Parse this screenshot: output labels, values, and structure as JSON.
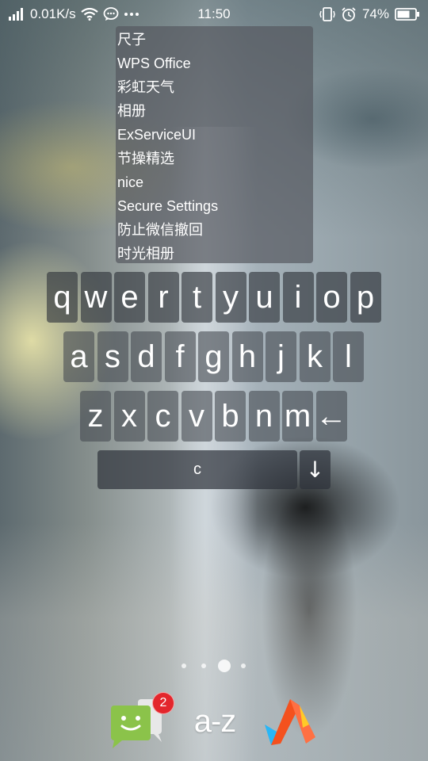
{
  "status_bar": {
    "network_speed": "0.01K/s",
    "time": "11:50",
    "battery": "74%",
    "icons": [
      "signal-icon",
      "wifi-icon",
      "message-icon",
      "more-icon",
      "vibrate-icon",
      "alarm-icon",
      "battery-icon"
    ]
  },
  "suggestions": [
    "尺子",
    "WPS Office",
    "彩虹天气",
    "相册",
    "ExServiceUI",
    "节操精选",
    "nice",
    "Secure Settings",
    "防止微信撤回",
    "时光相册"
  ],
  "keyboard": {
    "row1": [
      "q",
      "w",
      "e",
      "r",
      "t",
      "y",
      "u",
      "i",
      "o",
      "p"
    ],
    "row2": [
      "a",
      "s",
      "d",
      "f",
      "g",
      "h",
      "j",
      "k",
      "l"
    ],
    "row3": [
      "z",
      "x",
      "c",
      "v",
      "b",
      "n",
      "m",
      "←"
    ],
    "space_label": "c",
    "down_label": "↓"
  },
  "page_indicator": {
    "pages": 4,
    "current": 3
  },
  "dock": {
    "messages_badge": "2",
    "az_label": "a-z",
    "icons": [
      "messages-icon",
      "az-launcher-icon",
      "app-launcher-icon"
    ],
    "colors": {
      "messages_green": "#8bc34a",
      "badge_red": "#e3262c",
      "logo_orange": "#f4511e",
      "logo_blue": "#29b6f6"
    }
  }
}
